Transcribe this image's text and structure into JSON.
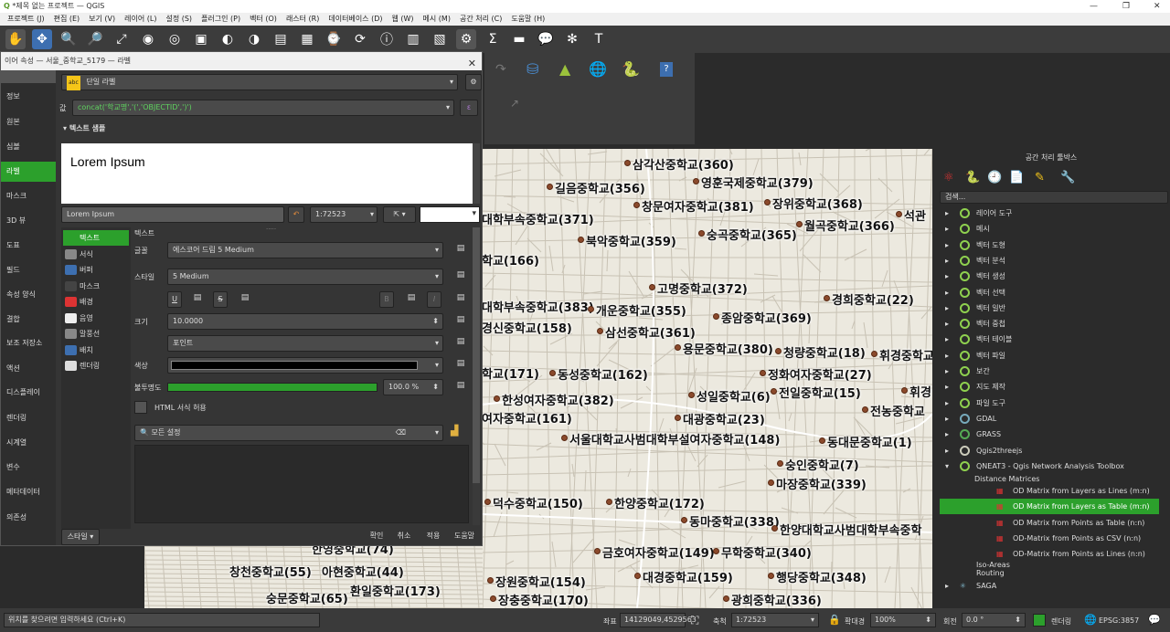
{
  "window": {
    "title": "*제목 없는 프로젝트 — QGIS"
  },
  "menu": [
    "프로젝트 (J)",
    "편집 (E)",
    "보기 (V)",
    "레이어 (L)",
    "설정 (S)",
    "플러그인 (P)",
    "벡터 (O)",
    "래스터 (R)",
    "데이터베이스 (D)",
    "웹 (W)",
    "메시 (M)",
    "공간 처리 (C)",
    "도움말 (H)"
  ],
  "dialog": {
    "title": "이어 속성 — 서울_중학교_5179 — 라벨",
    "mode": "단일 라벨",
    "expr_label": "값",
    "expression": "concat('학교명','(','OBJECTID',')')",
    "section": "텍스트 샘플",
    "preview_text": "Lorem Ipsum",
    "sample_input": "Lorem Ipsum",
    "scale": "1:72523",
    "tab_title": "텍스트",
    "side": [
      "정보",
      "원본",
      "심볼",
      "라벨",
      "마스크",
      "3D 뷰",
      "도표",
      "필드",
      "속성 양식",
      "결합",
      "보조 저장소",
      "액션",
      "디스플레이",
      "렌더링",
      "시계열",
      "변수",
      "메타데이터",
      "의존성"
    ],
    "subtabs": [
      "텍스트",
      "서식",
      "버퍼",
      "마스크",
      "배경",
      "음영",
      "말풍선",
      "배치",
      "렌더링"
    ],
    "font_label": "글꼴",
    "font_value": "에스코어 드림 5 Medium",
    "style_label": "스타일",
    "style_value": "5 Medium",
    "style_u": "U",
    "style_s": "S",
    "style_b": "B",
    "style_i": "I",
    "size_label": "크기",
    "size_value": "10.0000",
    "unit_value": "포인트",
    "color_label": "색상",
    "opacity_label": "불투명도",
    "opacity_value": "100.0 %",
    "opacity_level": 1.0,
    "html_label": "HTML 서식 허용",
    "search_placeholder": "모든 설정",
    "buttons": {
      "style": "스타일",
      "ok": "확인",
      "cancel": "취소",
      "apply": "적용",
      "help": "도움말"
    }
  },
  "map_labels": [
    {
      "t": "삼각산중학교(360)"
    },
    {
      "t": "영훈국제중학교(379)"
    },
    {
      "t": "길음중학교(356)"
    },
    {
      "t": "창문여자중학교(381)"
    },
    {
      "t": "장위중학교(368)"
    },
    {
      "t": "대학부속중학교(371)"
    },
    {
      "t": "숭곡중학교(365)"
    },
    {
      "t": "월곡중학교(366)"
    },
    {
      "t": "석관"
    },
    {
      "t": "북악중학교(359)"
    },
    {
      "t": "학교(166)"
    },
    {
      "t": "고명중학교(372)"
    },
    {
      "t": "경희중학교(22)"
    },
    {
      "t": "대학부속중학교(383)"
    },
    {
      "t": "개운중학교(355)"
    },
    {
      "t": "종암중학교(369)"
    },
    {
      "t": "경신중학교(158)"
    },
    {
      "t": "삼선중학교(361)"
    },
    {
      "t": "용문중학교(380)"
    },
    {
      "t": "청량중학교(18)"
    },
    {
      "t": "휘경중학교"
    },
    {
      "t": "학교(171)"
    },
    {
      "t": "동성중학교(162)"
    },
    {
      "t": "정화여자중학교(27)"
    },
    {
      "t": "성일중학교(6)"
    },
    {
      "t": "전일중학교(15)"
    },
    {
      "t": "휘경"
    },
    {
      "t": "한성여자중학교(382)"
    },
    {
      "t": "전농중학교"
    },
    {
      "t": "여자중학교(161)"
    },
    {
      "t": "대광중학교(23)"
    },
    {
      "t": "서울대학교사범대학부설여자중학교(148)"
    },
    {
      "t": "동대문중학교(1)"
    },
    {
      "t": "숭인중학교(7)"
    },
    {
      "t": "마장중학교(339)"
    },
    {
      "t": "덕수중학교(150)"
    },
    {
      "t": "한양중학교(172)"
    },
    {
      "t": "동마중학교(338)"
    },
    {
      "t": "한양대학교사범대학부속중학"
    },
    {
      "t": "한영중학교(74)"
    },
    {
      "t": "금호여자중학교(149)"
    },
    {
      "t": "무학중학교(340)"
    },
    {
      "t": "창천중학교(55)"
    },
    {
      "t": "아현중학교(44)"
    },
    {
      "t": "대경중학교(159)"
    },
    {
      "t": "행당중학교(348)"
    },
    {
      "t": "환일중학교(173)"
    },
    {
      "t": "장원중학교(154)"
    },
    {
      "t": "숭문중학교(65)"
    },
    {
      "t": "장충중학교(170)"
    },
    {
      "t": "광희중학교(336)"
    }
  ],
  "processing": {
    "title": "공간 처리 툴박스",
    "search_placeholder": "검색...",
    "items": [
      "레이어 도구",
      "메시",
      "벡터 도형",
      "벡터 분석",
      "벡터 생성",
      "벡터 선택",
      "벡터 일반",
      "벡터 중첩",
      "벡터 테이블",
      "벡터 파일",
      "보간",
      "지도 제작",
      "파일 도구",
      "GDAL",
      "GRASS",
      "Qgis2threejs",
      "QNEAT3 - Qgis Network Analysis Toolbox"
    ],
    "sub_group": "Distance Matrices",
    "sub_items": [
      "OD Matrix from Layers as Lines (m:n)",
      "OD Matrix from Layers as Table (m:n)",
      "OD Matrix from Points as Table (n:n)",
      "OD-Matrix from Points as CSV (n:n)",
      "OD-Matrix from Points as Lines (n:n)"
    ],
    "other_items": [
      "Iso-Areas",
      "Routing",
      "SAGA"
    ]
  },
  "status": {
    "locate_placeholder": "위치를 찾으려면 입력하세요 (Ctrl+K)",
    "coord_label": "좌표",
    "coord_value": "14129049,4529563",
    "scale_label": "축척",
    "scale_value": "1:72523",
    "magnifier_label": "확대경",
    "magnifier_value": "100%",
    "rotation_label": "회전",
    "rotation_value": "0.0 °",
    "render_label": "렌더링",
    "crs": "EPSG:3857"
  },
  "colors": {
    "accent": "#2ca02c",
    "map_bg": "#ece9df",
    "point": "#8b4a2c"
  }
}
